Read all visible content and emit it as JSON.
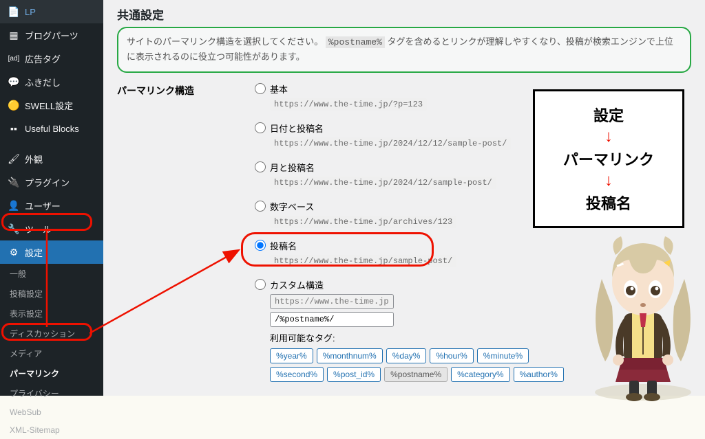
{
  "sidebar": {
    "items": [
      {
        "icon": "📄",
        "label": "LP"
      },
      {
        "icon": "▦",
        "label": "ブログパーツ"
      },
      {
        "icon": "[ad]",
        "label": "広告タグ"
      },
      {
        "icon": "💬",
        "label": "ふきだし"
      },
      {
        "icon": "🟡",
        "label": "SWELL設定"
      },
      {
        "icon": "▪▪",
        "label": "Useful Blocks"
      },
      {
        "icon": "🖌",
        "label": "外観"
      },
      {
        "icon": "🔌",
        "label": "プラグイン"
      },
      {
        "icon": "👤",
        "label": "ユーザー"
      },
      {
        "icon": "🔧",
        "label": "ツール"
      },
      {
        "icon": "⚙",
        "label": "設定",
        "active_main": true
      }
    ],
    "sub": [
      {
        "label": "一般"
      },
      {
        "label": "投稿設定"
      },
      {
        "label": "表示設定"
      },
      {
        "label": "ディスカッション"
      },
      {
        "label": "メディア"
      },
      {
        "label": "パーマリンク",
        "active": true
      },
      {
        "label": "プライバシー"
      },
      {
        "label": "WebSub"
      },
      {
        "label": "XML-Sitemap"
      }
    ]
  },
  "section_title": "共通設定",
  "info_text_1": "サイトのパーマリンク構造を選択してください。",
  "info_code": "%postname%",
  "info_text_2": "タグを含めるとリンクが理解しやすくなり、投稿が検索エンジンで上位に表示されるのに役立つ可能性があります。",
  "struct_label": "パーマリンク構造",
  "options": [
    {
      "label": "基本",
      "sample": "https://www.the-time.jp/?p=123"
    },
    {
      "label": "日付と投稿名",
      "sample": "https://www.the-time.jp/2024/12/12/sample-post/"
    },
    {
      "label": "月と投稿名",
      "sample": "https://www.the-time.jp/2024/12/sample-post/"
    },
    {
      "label": "数字ベース",
      "sample": "https://www.the-time.jp/archives/123"
    },
    {
      "label": "投稿名",
      "sample": "https://www.the-time.jp/sample-post/",
      "selected": true
    },
    {
      "label": "カスタム構造"
    }
  ],
  "custom_base": "https://www.the-time.jp",
  "custom_value": "/%postname%/",
  "tags_label": "利用可能なタグ:",
  "tags": [
    "%year%",
    "%monthnum%",
    "%day%",
    "%hour%",
    "%minute%",
    "%second%",
    "%post_id%",
    "%postname%",
    "%category%",
    "%author%"
  ],
  "callout": {
    "a": "設定",
    "b": "パーマリンク",
    "c": "投稿名"
  }
}
